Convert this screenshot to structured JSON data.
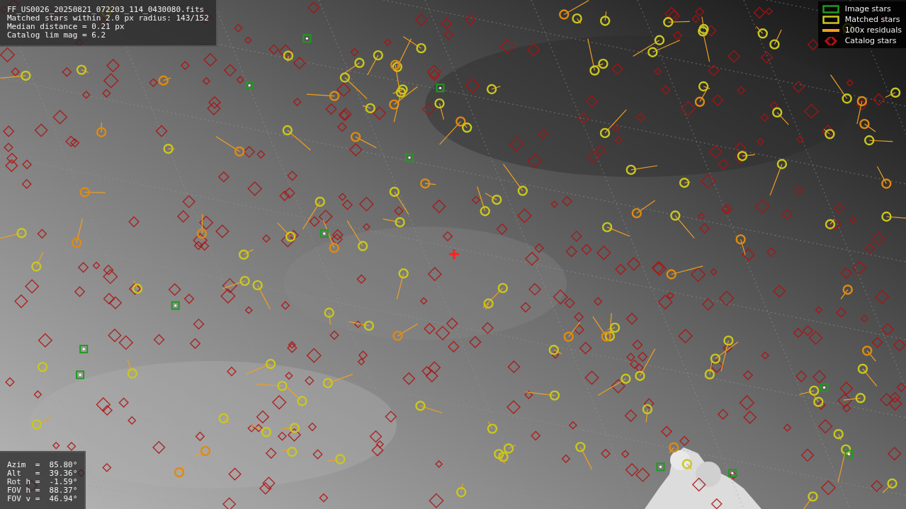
{
  "file_info": {
    "lines": [
      "FF_US0026_20250821_072203_114_0430080.fits",
      "Matched stars within 2.0 px radius: 143/152",
      "Median distance = 0.21 px",
      "Catalog lim mag = 6.2"
    ]
  },
  "legend": [
    {
      "kind": "image",
      "label": "Image stars",
      "color": "#1f9a1f"
    },
    {
      "kind": "matched",
      "label": "Matched stars",
      "color": "#c8c81e"
    },
    {
      "kind": "residual",
      "label": "100x residuals",
      "color": "#f0a020"
    },
    {
      "kind": "catalog",
      "label": "Catalog stars",
      "color": "#b01010"
    }
  ],
  "pointing": {
    "lines": [
      "Azim  =  85.80°",
      "Alt   =  39.36°",
      "Rot h =  -1.59°",
      "FOV h =  88.37°",
      "FOV v =  46.94°"
    ]
  }
}
